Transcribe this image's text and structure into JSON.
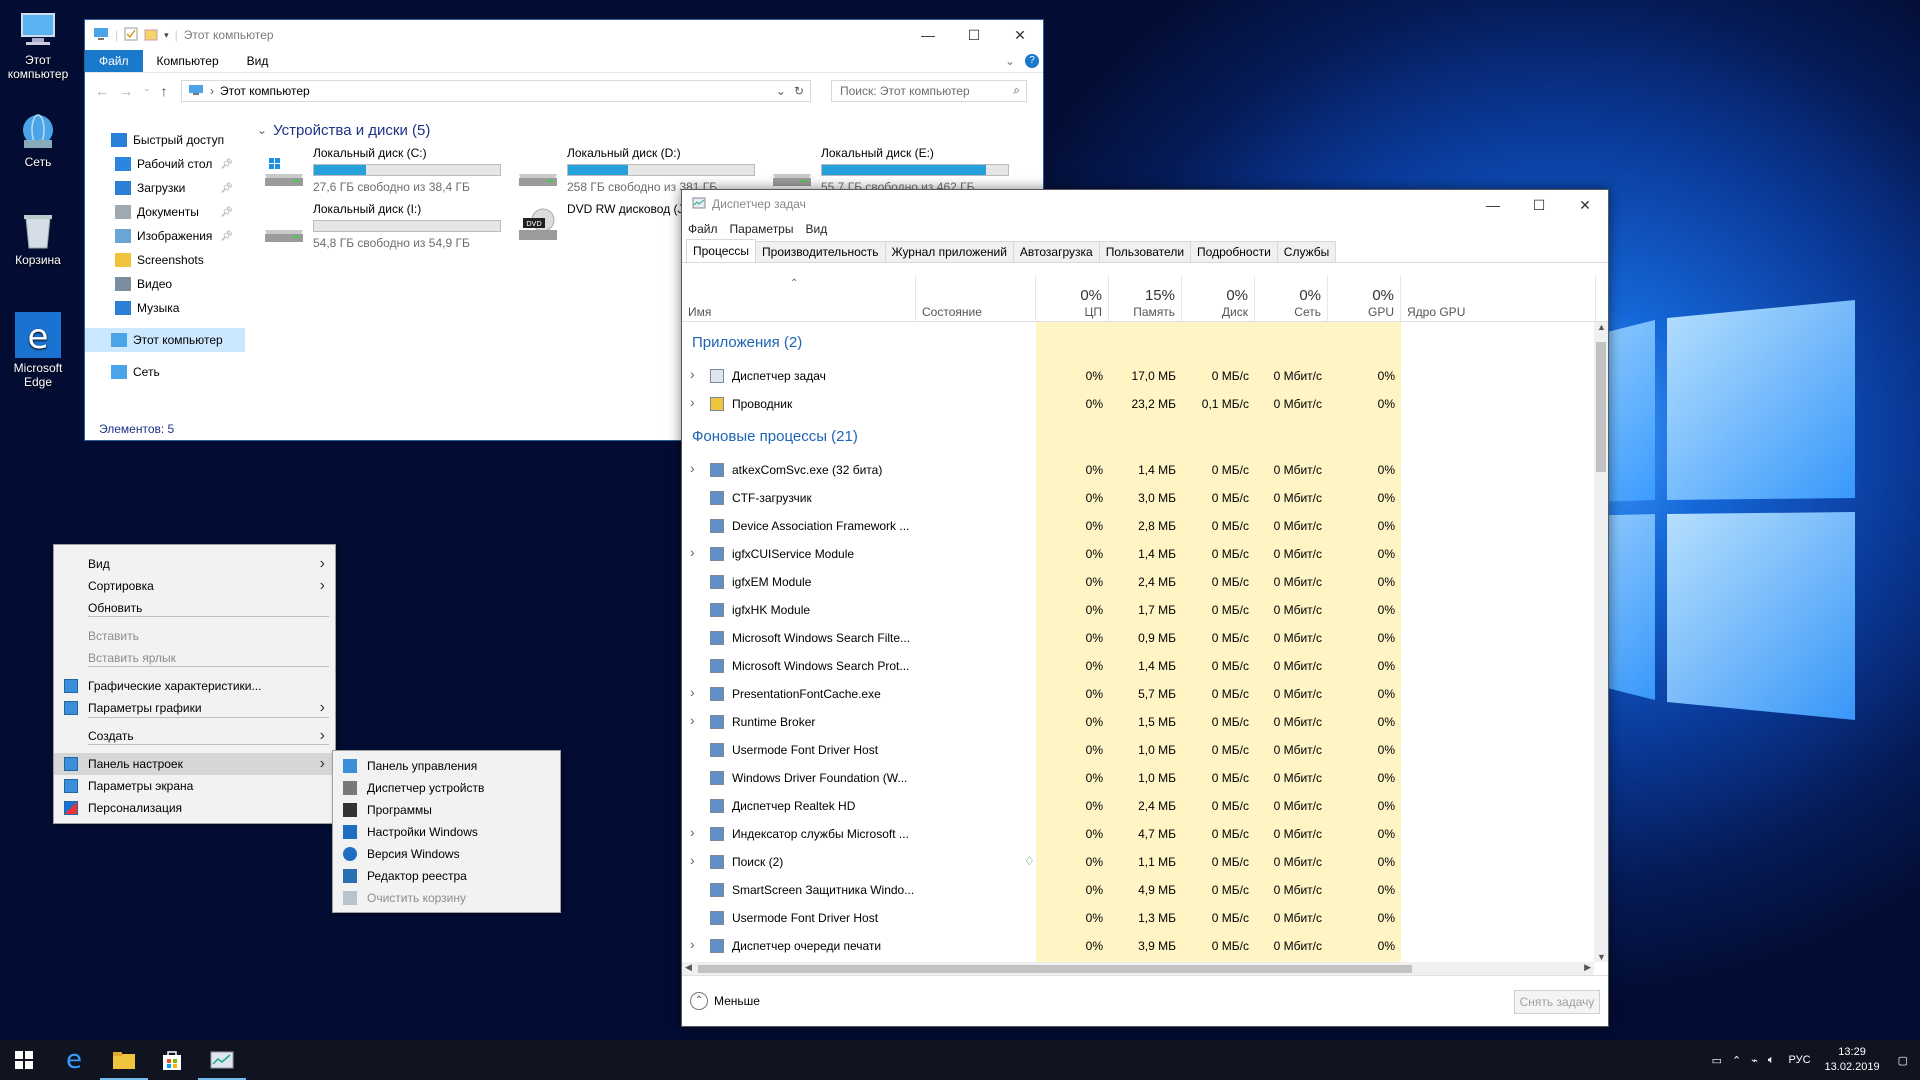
{
  "desktop": {
    "icons": [
      {
        "label": "Этот компьютер"
      },
      {
        "label": "Сеть"
      },
      {
        "label": "Корзина"
      },
      {
        "label": "Microsoft Edge"
      }
    ]
  },
  "explorer": {
    "title": "Этот компьютер",
    "ribbon_tabs": [
      "Файл",
      "Компьютер",
      "Вид"
    ],
    "address": "Этот компьютер",
    "search_placeholder": "Поиск: Этот компьютер",
    "sidebar": [
      {
        "label": "Быстрый доступ",
        "icon": "star-icon",
        "pin": false
      },
      {
        "label": "Рабочий стол",
        "icon": "desktop-folder-icon",
        "pin": true
      },
      {
        "label": "Загрузки",
        "icon": "downloads-icon",
        "pin": true
      },
      {
        "label": "Документы",
        "icon": "documents-icon",
        "pin": true
      },
      {
        "label": "Изображения",
        "icon": "pictures-icon",
        "pin": true
      },
      {
        "label": "Screenshots",
        "icon": "folder-icon",
        "pin": false
      },
      {
        "label": "Видео",
        "icon": "video-icon",
        "pin": false
      },
      {
        "label": "Музыка",
        "icon": "music-icon",
        "pin": false
      },
      {
        "label": "Этот компьютер",
        "icon": "computer-icon",
        "pin": false,
        "selected": true
      },
      {
        "label": "Сеть",
        "icon": "network-icon",
        "pin": false
      }
    ],
    "group_title": "Устройства и диски (5)",
    "drives": [
      {
        "name": "Локальный диск (C:)",
        "free": "27,6 ГБ свободно из 38,4 ГБ",
        "used_fraction": 0.28,
        "bar": true
      },
      {
        "name": "Локальный диск (D:)",
        "free": "258 ГБ свободно из 381 ГБ",
        "used_fraction": 0.32,
        "bar": true
      },
      {
        "name": "Локальный диск (E:)",
        "free": "55,7 ГБ свободно из 462 ГБ",
        "used_fraction": 0.88,
        "bar": true
      },
      {
        "name": "Локальный диск (I:)",
        "free": "54,8 ГБ свободно из 54,9 ГБ",
        "used_fraction": 0.0,
        "bar": true
      },
      {
        "name": "DVD RW дисковод (J:)",
        "free": "",
        "bar": false
      }
    ],
    "status": "Элементов: 5"
  },
  "context_menu": {
    "items": [
      {
        "label": "Вид",
        "arrow": true
      },
      {
        "label": "Сортировка",
        "arrow": true
      },
      {
        "label": "Обновить"
      },
      {
        "label": "Вставить",
        "disabled": true
      },
      {
        "label": "Вставить ярлык",
        "disabled": true
      },
      {
        "label": "Графические характеристики...",
        "icon": true
      },
      {
        "label": "Параметры графики",
        "icon": true,
        "arrow": true
      },
      {
        "label": "Создать",
        "arrow": true
      },
      {
        "label": "Панель настроек",
        "icon": true,
        "arrow": true,
        "highlighted": true
      },
      {
        "label": "Параметры экрана",
        "icon": true
      },
      {
        "label": "Персонализация",
        "icon": true
      }
    ],
    "submenu": [
      {
        "label": "Панель управления"
      },
      {
        "label": "Диспетчер устройств"
      },
      {
        "label": "Программы"
      },
      {
        "label": "Настройки Windows"
      },
      {
        "label": "Версия Windows"
      },
      {
        "label": "Редактор реестра"
      },
      {
        "label": "Очистить корзину",
        "disabled": true
      }
    ]
  },
  "taskmgr": {
    "title": "Диспетчер задач",
    "menu": [
      "Файл",
      "Параметры",
      "Вид"
    ],
    "tabs": [
      "Процессы",
      "Производительность",
      "Журнал приложений",
      "Автозагрузка",
      "Пользователи",
      "Подробности",
      "Службы"
    ],
    "columns": {
      "name": "Имя",
      "status": "Состояние",
      "cpu": {
        "pct": "0%",
        "label": "ЦП"
      },
      "mem": {
        "pct": "15%",
        "label": "Память"
      },
      "disk": {
        "pct": "0%",
        "label": "Диск"
      },
      "net": {
        "pct": "0%",
        "label": "Сеть"
      },
      "gpu": {
        "pct": "0%",
        "label": "GPU"
      },
      "gpu_engine": "Ядро GPU"
    },
    "apps_title": "Приложения (2)",
    "apps": [
      {
        "name": "Диспетчер задач",
        "exp": true,
        "cpu": "0%",
        "mem": "17,0 МБ",
        "disk": "0 МБ/с",
        "net": "0 Мбит/с",
        "gpu": "0%"
      },
      {
        "name": "Проводник",
        "exp": true,
        "cpu": "0%",
        "mem": "23,2 МБ",
        "disk": "0,1 МБ/с",
        "net": "0 Мбит/с",
        "gpu": "0%"
      }
    ],
    "bg_title": "Фоновые процессы (21)",
    "bg": [
      {
        "name": "atkexComSvc.exe (32 бита)",
        "exp": true,
        "cpu": "0%",
        "mem": "1,4 МБ",
        "disk": "0 МБ/с",
        "net": "0 Мбит/с",
        "gpu": "0%"
      },
      {
        "name": "CTF-загрузчик",
        "exp": false,
        "cpu": "0%",
        "mem": "3,0 МБ",
        "disk": "0 МБ/с",
        "net": "0 Мбит/с",
        "gpu": "0%"
      },
      {
        "name": "Device Association Framework ...",
        "exp": false,
        "cpu": "0%",
        "mem": "2,8 МБ",
        "disk": "0 МБ/с",
        "net": "0 Мбит/с",
        "gpu": "0%"
      },
      {
        "name": "igfxCUIService Module",
        "exp": true,
        "cpu": "0%",
        "mem": "1,4 МБ",
        "disk": "0 МБ/с",
        "net": "0 Мбит/с",
        "gpu": "0%"
      },
      {
        "name": "igfxEM Module",
        "exp": false,
        "cpu": "0%",
        "mem": "2,4 МБ",
        "disk": "0 МБ/с",
        "net": "0 Мбит/с",
        "gpu": "0%"
      },
      {
        "name": "igfxHK Module",
        "exp": false,
        "cpu": "0%",
        "mem": "1,7 МБ",
        "disk": "0 МБ/с",
        "net": "0 Мбит/с",
        "gpu": "0%"
      },
      {
        "name": "Microsoft Windows Search Filte...",
        "exp": false,
        "cpu": "0%",
        "mem": "0,9 МБ",
        "disk": "0 МБ/с",
        "net": "0 Мбит/с",
        "gpu": "0%"
      },
      {
        "name": "Microsoft Windows Search Prot...",
        "exp": false,
        "cpu": "0%",
        "mem": "1,4 МБ",
        "disk": "0 МБ/с",
        "net": "0 Мбит/с",
        "gpu": "0%"
      },
      {
        "name": "PresentationFontCache.exe",
        "exp": true,
        "cpu": "0%",
        "mem": "5,7 МБ",
        "disk": "0 МБ/с",
        "net": "0 Мбит/с",
        "gpu": "0%"
      },
      {
        "name": "Runtime Broker",
        "exp": true,
        "cpu": "0%",
        "mem": "1,5 МБ",
        "disk": "0 МБ/с",
        "net": "0 Мбит/с",
        "gpu": "0%"
      },
      {
        "name": "Usermode Font Driver Host",
        "exp": false,
        "cpu": "0%",
        "mem": "1,0 МБ",
        "disk": "0 МБ/с",
        "net": "0 Мбит/с",
        "gpu": "0%"
      },
      {
        "name": "Windows Driver Foundation (W...",
        "exp": false,
        "cpu": "0%",
        "mem": "1,0 МБ",
        "disk": "0 МБ/с",
        "net": "0 Мбит/с",
        "gpu": "0%"
      },
      {
        "name": "Диспетчер Realtek HD",
        "exp": false,
        "cpu": "0%",
        "mem": "2,4 МБ",
        "disk": "0 МБ/с",
        "net": "0 Мбит/с",
        "gpu": "0%"
      },
      {
        "name": "Индексатор службы Microsoft ...",
        "exp": true,
        "cpu": "0%",
        "mem": "4,7 МБ",
        "disk": "0 МБ/с",
        "net": "0 Мбит/с",
        "gpu": "0%"
      },
      {
        "name": "Поиск (2)",
        "exp": true,
        "cpu": "0%",
        "mem": "1,1 МБ",
        "disk": "0 МБ/с",
        "net": "0 Мбит/с",
        "gpu": "0%",
        "suspended": true
      },
      {
        "name": "SmartScreen Защитника Windo...",
        "exp": false,
        "cpu": "0%",
        "mem": "4,9 МБ",
        "disk": "0 МБ/с",
        "net": "0 Мбит/с",
        "gpu": "0%"
      },
      {
        "name": "Usermode Font Driver Host",
        "exp": false,
        "cpu": "0%",
        "mem": "1,3 МБ",
        "disk": "0 МБ/с",
        "net": "0 Мбит/с",
        "gpu": "0%"
      },
      {
        "name": "Диспетчер очереди печати",
        "exp": true,
        "cpu": "0%",
        "mem": "3,9 МБ",
        "disk": "0 МБ/с",
        "net": "0 Мбит/с",
        "gpu": "0%"
      }
    ],
    "less_label": "Меньше",
    "end_task_label": "Снять задачу"
  },
  "taskbar": {
    "lang": "РУС",
    "time": "13:29",
    "date": "13.02.2019"
  },
  "colors": {
    "accent": "#1979ca",
    "highlight_column": "#fff4c4",
    "drive_bar": "#26a0da"
  }
}
